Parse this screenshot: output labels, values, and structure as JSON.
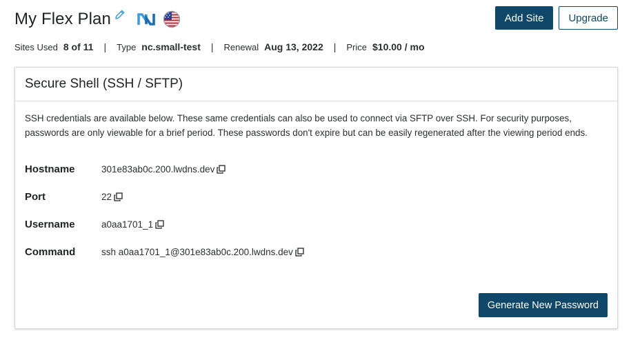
{
  "header": {
    "title": "My Flex Plan",
    "add_site_label": "Add Site",
    "upgrade_label": "Upgrade"
  },
  "meta": {
    "sites_used_label": "Sites Used",
    "sites_used_value": "8 of 11",
    "type_label": "Type",
    "type_value": "nc.small-test",
    "renewal_label": "Renewal",
    "renewal_value": "Aug 13, 2022",
    "price_label": "Price",
    "price_value": "$10.00 / mo",
    "separator": "|"
  },
  "ssh": {
    "title": "Secure Shell (SSH / SFTP)",
    "description": "SSH credentials are available below. These same credentials can also be used to connect via SFTP over SSH. For security purposes, passwords are only viewable for a brief period. These passwords don't expire but can be easily regenerated after the viewing period ends.",
    "rows": [
      {
        "label": "Hostname",
        "value": "301e83ab0c.200.lwdns.dev"
      },
      {
        "label": "Port",
        "value": "22"
      },
      {
        "label": "Username",
        "value": "a0aa1701_1"
      },
      {
        "label": "Command",
        "value": "ssh a0aa1701_1@301e83ab0c.200.lwdns.dev"
      }
    ],
    "generate_label": "Generate New Password"
  },
  "icons": {
    "edit": "pencil-icon",
    "brand": "nexcess-logo-icon",
    "region": "us-flag-icon",
    "copy": "copy-icon"
  },
  "colors": {
    "primary": "#0f4768",
    "edit_icon": "#3f9ad8",
    "logo": "#3f9ad8"
  }
}
